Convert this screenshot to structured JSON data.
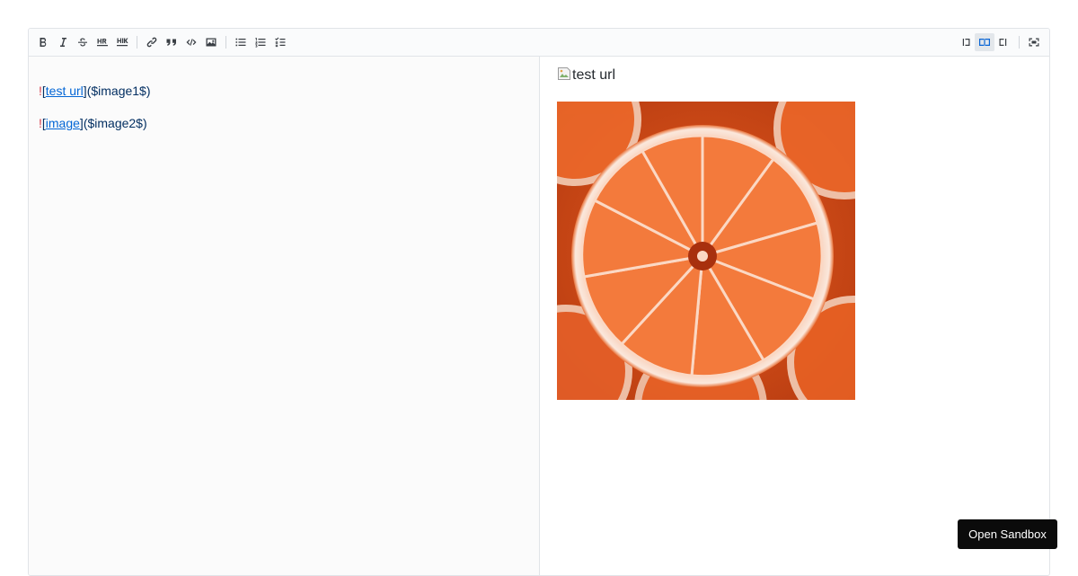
{
  "toolbar": {
    "left_buttons": [
      "bold-icon",
      "italic-icon",
      "strikethrough-icon",
      "horizontal-rule-icon",
      "heading-icon",
      "link-icon",
      "quote-icon",
      "code-icon",
      "image-icon",
      "bullet-list-icon",
      "ordered-list-icon",
      "task-list-icon"
    ],
    "right_buttons": [
      "editor-only-icon",
      "split-view-icon",
      "preview-only-icon",
      "fullscreen-icon"
    ],
    "active_view": "split-view"
  },
  "source": {
    "line1": {
      "mark": "!",
      "open": "[",
      "alt": "test url",
      "close": "]",
      "url": "($image1$)"
    },
    "line2": {
      "mark": "!",
      "open": "[",
      "alt": "image",
      "close": "]",
      "url": "($image2$)"
    }
  },
  "preview": {
    "broken_image_alt": "test url",
    "image2_alt": "image"
  },
  "sandbox_button_label": "Open Sandbox",
  "colors": {
    "accent": "#0366d6",
    "markdown_mark": "#d73a49",
    "button_bg": "#0b0b0b"
  }
}
